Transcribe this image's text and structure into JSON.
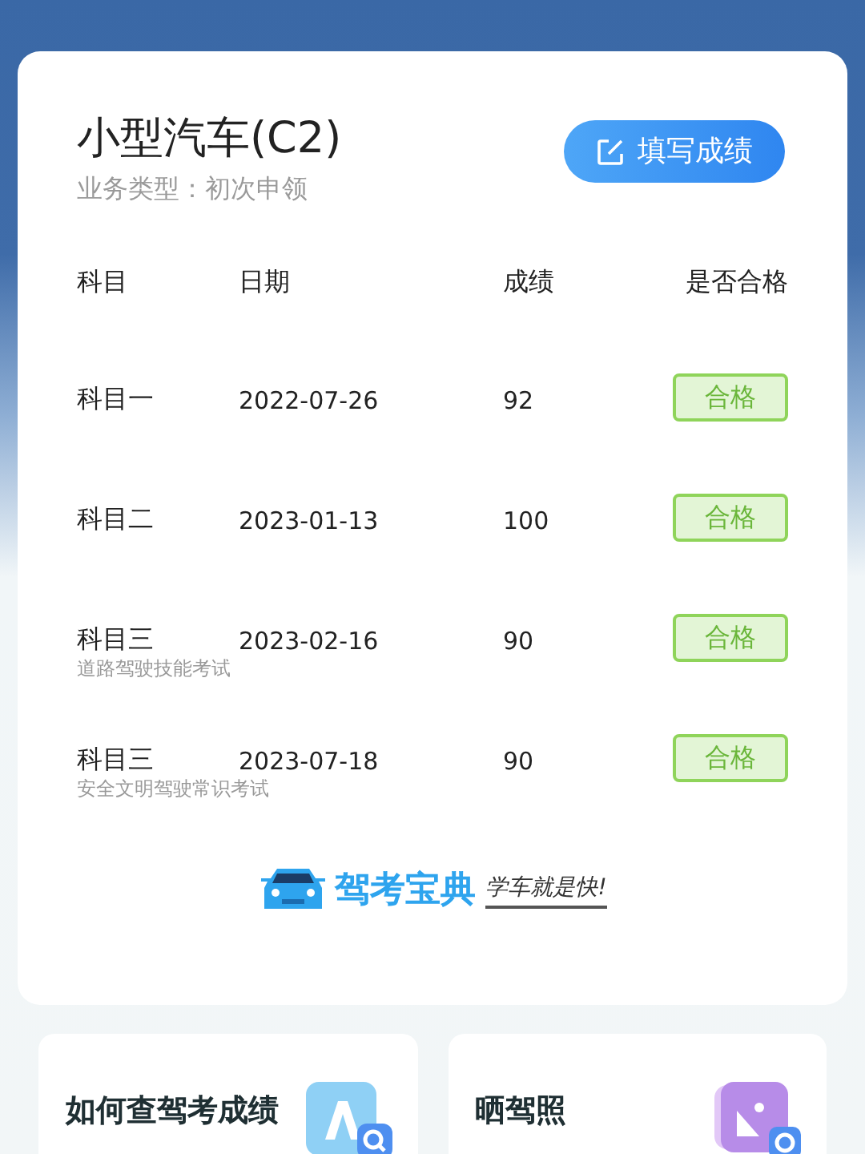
{
  "card": {
    "title": "小型汽车(C2)",
    "subtitle": "业务类型：初次申领",
    "button": "填写成绩",
    "columns": [
      "科目",
      "日期",
      "成绩",
      "是否合格"
    ],
    "rows": [
      {
        "subject": "科目一",
        "date": "2022-07-26",
        "score": "92",
        "result": "合格",
        "passed": true
      },
      {
        "subject": "科目二",
        "date": "2023-01-13",
        "score": "100",
        "result": "合格",
        "passed": true
      },
      {
        "subject": "科目三",
        "note": "道路驾驶技能考试",
        "date": "2023-02-16",
        "score": "90",
        "result": "合格",
        "passed": true
      },
      {
        "subject": "科目三",
        "note": "安全文明驾驶常识考试",
        "date": "2023-07-18",
        "score": "90",
        "result": "合格",
        "passed": true
      }
    ],
    "brand": "驾考宝典",
    "slogan": "学车就是快!"
  },
  "shortcuts": [
    {
      "label": "如何查驾考成绩",
      "kind": "search"
    },
    {
      "label": "晒驾照",
      "kind": "photo"
    }
  ]
}
